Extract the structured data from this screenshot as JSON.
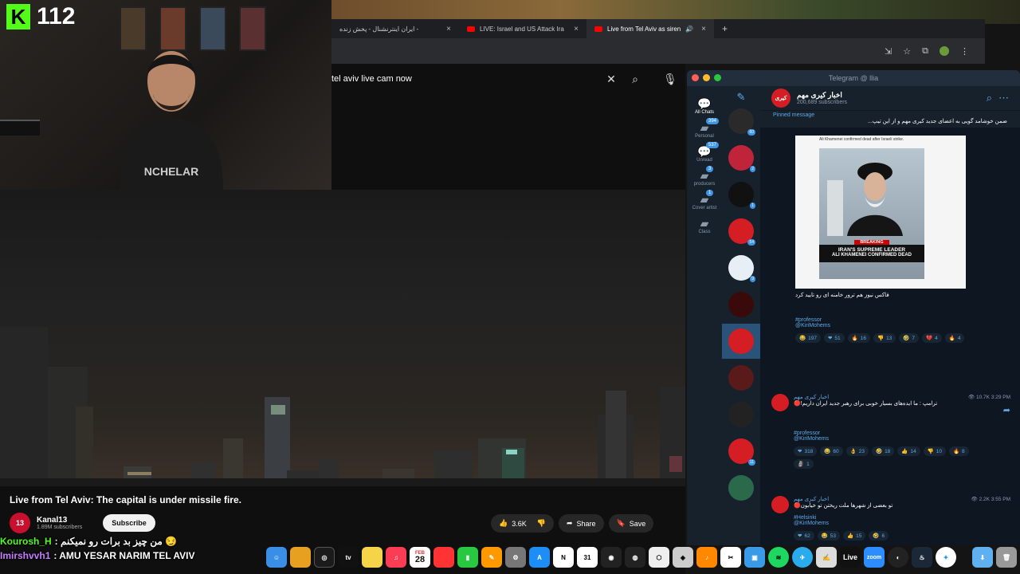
{
  "webcam": {
    "platform_letter": "K",
    "viewer_count": "112"
  },
  "browser": {
    "tabs": [
      {
        "label": "ایران اینترنشنال - پخش زنده -"
      },
      {
        "label": "LIVE: Israel and US Attack Ira"
      },
      {
        "label": "Live from Tel Aviv as siren"
      }
    ],
    "new_tab": "+",
    "search_query": "tel aviv live cam now"
  },
  "video": {
    "title": "Live from Tel Aviv: The capital is under missile fire.",
    "channel_name": "Kanal13",
    "channel_avatar": "13",
    "channel_subs": "1.89M subscribers",
    "subscribe": "Subscribe",
    "likes": "3.6K",
    "share": "Share",
    "save": "Save"
  },
  "chat_overlay": [
    {
      "user": "Kourosh_H",
      "user_color": "#53fc18",
      "message": ": من چیز بد برات رو نمیکنم 😏"
    },
    {
      "user": "Imirshvvh1",
      "user_color": "#c77dff",
      "message": ": AMU YESAR NARIM TEL AVIV"
    }
  ],
  "dock": {
    "appletv": "tv",
    "calendar_month": "FEB",
    "calendar_day": "28",
    "live": "Live",
    "zoom": "zoom"
  },
  "telegram": {
    "window_title": "Telegram @ llia",
    "folders": [
      {
        "label": "All Chats",
        "badge": ""
      },
      {
        "label": "Personal",
        "badge": "394"
      },
      {
        "label": "Unread",
        "badge": "537"
      },
      {
        "label": "producers",
        "badge": "3"
      },
      {
        "label": "Cover artist",
        "badge": "1"
      },
      {
        "label": "Class",
        "badge": ""
      }
    ],
    "chat_badges": [
      "60",
      "2",
      "1",
      "54",
      "9",
      "",
      "",
      "",
      "",
      "11",
      ""
    ],
    "channel": {
      "name": "اخبار کیری مهم",
      "subscribers": "200,689 subscribers"
    },
    "pinned": {
      "label": "Pinned message",
      "text": "ضمن خوشامد گویی به اعضای جدید کیری مهم و از این تیپ..."
    },
    "image_card": {
      "caption_top": "Ali Khamenei confirmed dead after Israeli strike.",
      "breaking": "BREAKING",
      "headline1": "IRAN'S SUPREME LEADER",
      "headline2": "ALI KHAMENEI CONFIRMED DEAD"
    },
    "messages": [
      {
        "sender": "",
        "text": "فاکس نیوز هم ترور خامنه ای رو تایید کرد",
        "tag1": "#professor",
        "tag2": "@KiriMohems",
        "reactions": [
          {
            "emoji": "😂",
            "count": "197"
          },
          {
            "emoji": "❤",
            "count": "51"
          },
          {
            "emoji": "🔥",
            "count": "16"
          },
          {
            "emoji": "👎",
            "count": "13"
          },
          {
            "emoji": "🤣",
            "count": "7"
          },
          {
            "emoji": "💔",
            "count": "4"
          },
          {
            "emoji": "🔥",
            "count": "4"
          }
        ],
        "views": "",
        "time": ""
      },
      {
        "sender": "اخبار کیری مهم",
        "text": "ترامپ : ما ایده‌های بسیار خوبی برای رهبر جدید ایران داریم!🔴",
        "tag1": "#professor",
        "tag2": "@KiriMohems",
        "reactions": [
          {
            "emoji": "❤",
            "count": "318"
          },
          {
            "emoji": "😂",
            "count": "60"
          },
          {
            "emoji": "👌",
            "count": "23"
          },
          {
            "emoji": "🤣",
            "count": "18"
          },
          {
            "emoji": "👍",
            "count": "14"
          },
          {
            "emoji": "👎",
            "count": "10"
          },
          {
            "emoji": "🔥",
            "count": "8"
          },
          {
            "emoji": "🗿",
            "count": "1"
          }
        ],
        "views": "10.7K",
        "time": "3:29 PM"
      },
      {
        "sender": "اخبار کیری مهم",
        "text": "تو بعضی از شهرها ملت ریختن تو خیابون🔴",
        "tag1": "#Helsinki",
        "tag2": "@KiriMohems",
        "reactions": [
          {
            "emoji": "❤",
            "count": "62"
          },
          {
            "emoji": "😂",
            "count": "53"
          },
          {
            "emoji": "👍",
            "count": "15"
          },
          {
            "emoji": "🤣",
            "count": "6"
          }
        ],
        "views": "2.2K",
        "time": "3:55 PM"
      }
    ]
  },
  "colors": {
    "telegram_bg": "#0e1621",
    "telegram_accent": "#5fa9e6",
    "youtube_red": "#ff0000",
    "kick_green": "#53fc18"
  }
}
